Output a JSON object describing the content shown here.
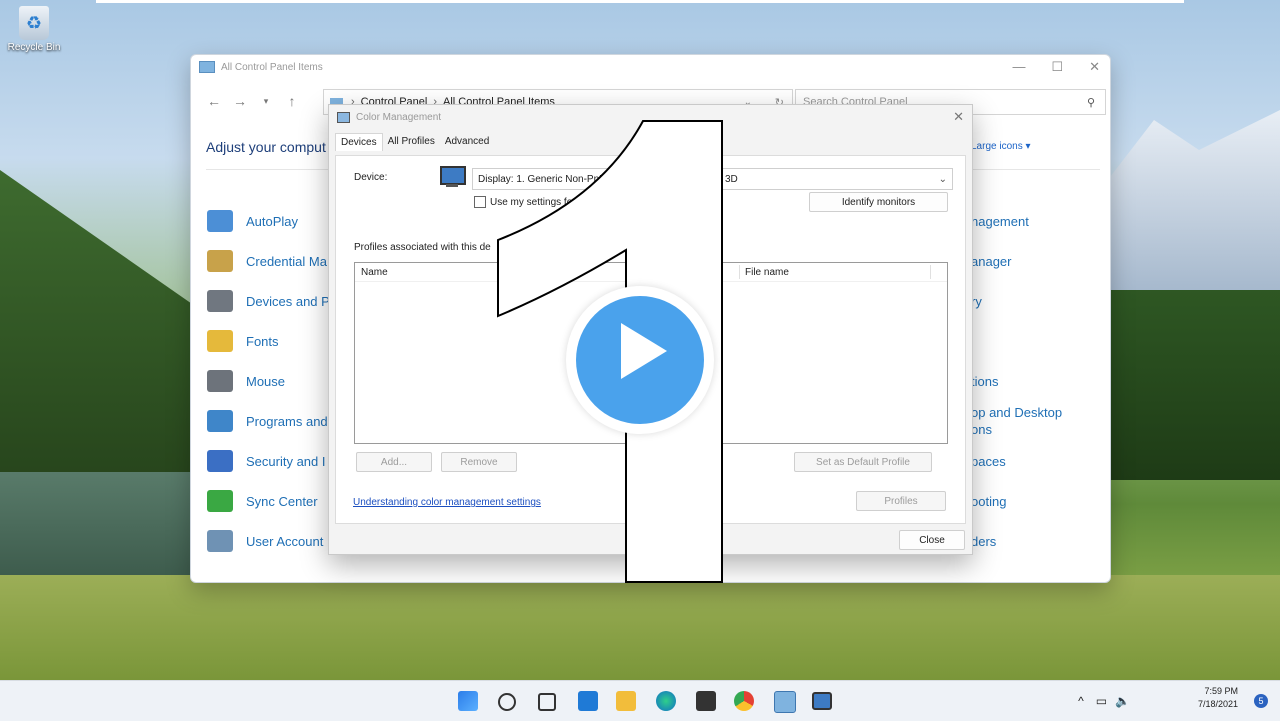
{
  "desktop": {
    "recycle_bin_label": "Recycle Bin"
  },
  "control_panel": {
    "window_title": "All Control Panel Items",
    "breadcrumb": [
      "Control Panel",
      "All Control Panel Items"
    ],
    "search_placeholder": "Search Control Panel",
    "heading": "Adjust your comput",
    "view_by": "Large icons ▾",
    "left_items": [
      {
        "label": "AutoPlay",
        "color": "#4c8fd6"
      },
      {
        "label": "Credential Ma",
        "color": "#c8a24a"
      },
      {
        "label": "Devices and P",
        "color": "#707780"
      },
      {
        "label": "Fonts",
        "color": "#e5b93b"
      },
      {
        "label": "Mouse",
        "color": "#6d737b"
      },
      {
        "label": "Programs and",
        "color": "#3f86c9"
      },
      {
        "label": "Security and I",
        "color": "#3b6fc4"
      },
      {
        "label": "Sync Center",
        "color": "#3aa843"
      },
      {
        "label": "User Account",
        "color": "#6f92b4"
      }
    ],
    "right_items": [
      "nagement",
      "anager",
      "ry",
      "",
      "tions",
      "op and Desktop\nons",
      "paces",
      "ooting",
      "ders"
    ]
  },
  "dialog": {
    "title": "Color Management",
    "tabs": [
      "Devices",
      "All Profiles",
      "Advanced"
    ],
    "device_label": "Device:",
    "device_value": "Display: 1. Generic Non-PnP Monitor - Microsoft Basic Display Adapter 3D",
    "device_value_visible": "Display: 1. Generic Non-PnP",
    "device_value_tail": "3D",
    "use_settings_label": "Use my settings fo",
    "identify_button": "Identify monitors",
    "profiles_label": "Profiles associated with this de",
    "columns": [
      "Name",
      "File name"
    ],
    "add_button": "Add...",
    "remove_button": "Remove",
    "set_default_button": "Set as Default Profile",
    "link": "Understanding color management settings",
    "profiles_button": "Profiles",
    "close_button": "Close"
  },
  "taskbar": {
    "time": "7:59 PM",
    "date": "7/18/2021",
    "notifications": "5",
    "apps": [
      "start-icon",
      "search-icon",
      "task-view-icon",
      "widgets-icon",
      "file-explorer-icon",
      "edge-icon",
      "store-icon",
      "chrome-icon",
      "control-panel-icon",
      "color-management-icon"
    ]
  },
  "overlay": {
    "numeral": "1"
  }
}
